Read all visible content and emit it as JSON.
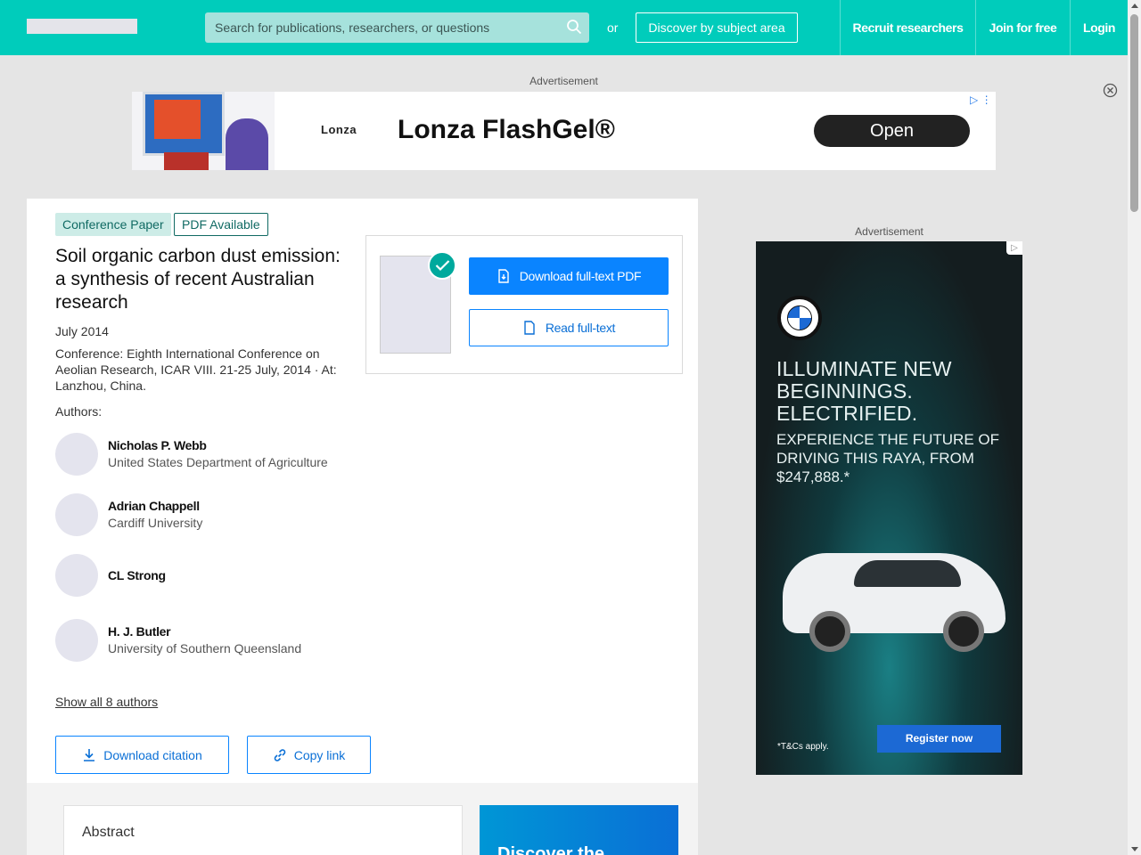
{
  "header": {
    "search_placeholder": "Search for publications, researchers, or questions",
    "or_text": "or",
    "discover_label": "Discover by subject area",
    "nav": [
      "Recruit researchers",
      "Join for free",
      "Login"
    ]
  },
  "ads": {
    "label": "Advertisement",
    "top": {
      "brand": "Lonza",
      "title": "Lonza FlashGel®",
      "cta": "Open"
    },
    "side": {
      "headline": "ILLUMINATE NEW BEGINNINGS. ELECTRIFIED.",
      "subhead": "EXPERIENCE THE FUTURE OF DRIVING THIS RAYA, FROM $247,888.*",
      "terms": "*T&Cs apply.",
      "cta": "Register now",
      "brand_color": "#1c69d4"
    }
  },
  "publication": {
    "type_badge": "Conference Paper",
    "pdf_badge": "PDF Available",
    "title": "Soil organic carbon dust emission: a synthesis of recent Australian research",
    "date": "July 2014",
    "conference": "Conference: Eighth International Conference on Aeolian Research, ICAR VIII. 21-25 July, 2014 · At: Lanzhou, China.",
    "authors_label": "Authors:",
    "authors": [
      {
        "name": "Nicholas P. Webb",
        "affiliation": "United States Department of Agriculture"
      },
      {
        "name": "Adrian Chappell",
        "affiliation": "Cardiff University"
      },
      {
        "name": "CL Strong",
        "affiliation": ""
      },
      {
        "name": "H. J. Butler",
        "affiliation": "University of Southern Queensland"
      }
    ],
    "show_all_authors": "Show all 8 authors",
    "download_citation": "Download citation",
    "copy_link": "Copy link",
    "download_pdf": "Download full-text PDF",
    "read_full_text": "Read full-text",
    "abstract_title": "Abstract",
    "promo_text": "Discover the"
  },
  "colors": {
    "header_bg": "#00ccbb",
    "primary_blue": "#0a84ff",
    "teal_badge": "#cdece7"
  }
}
